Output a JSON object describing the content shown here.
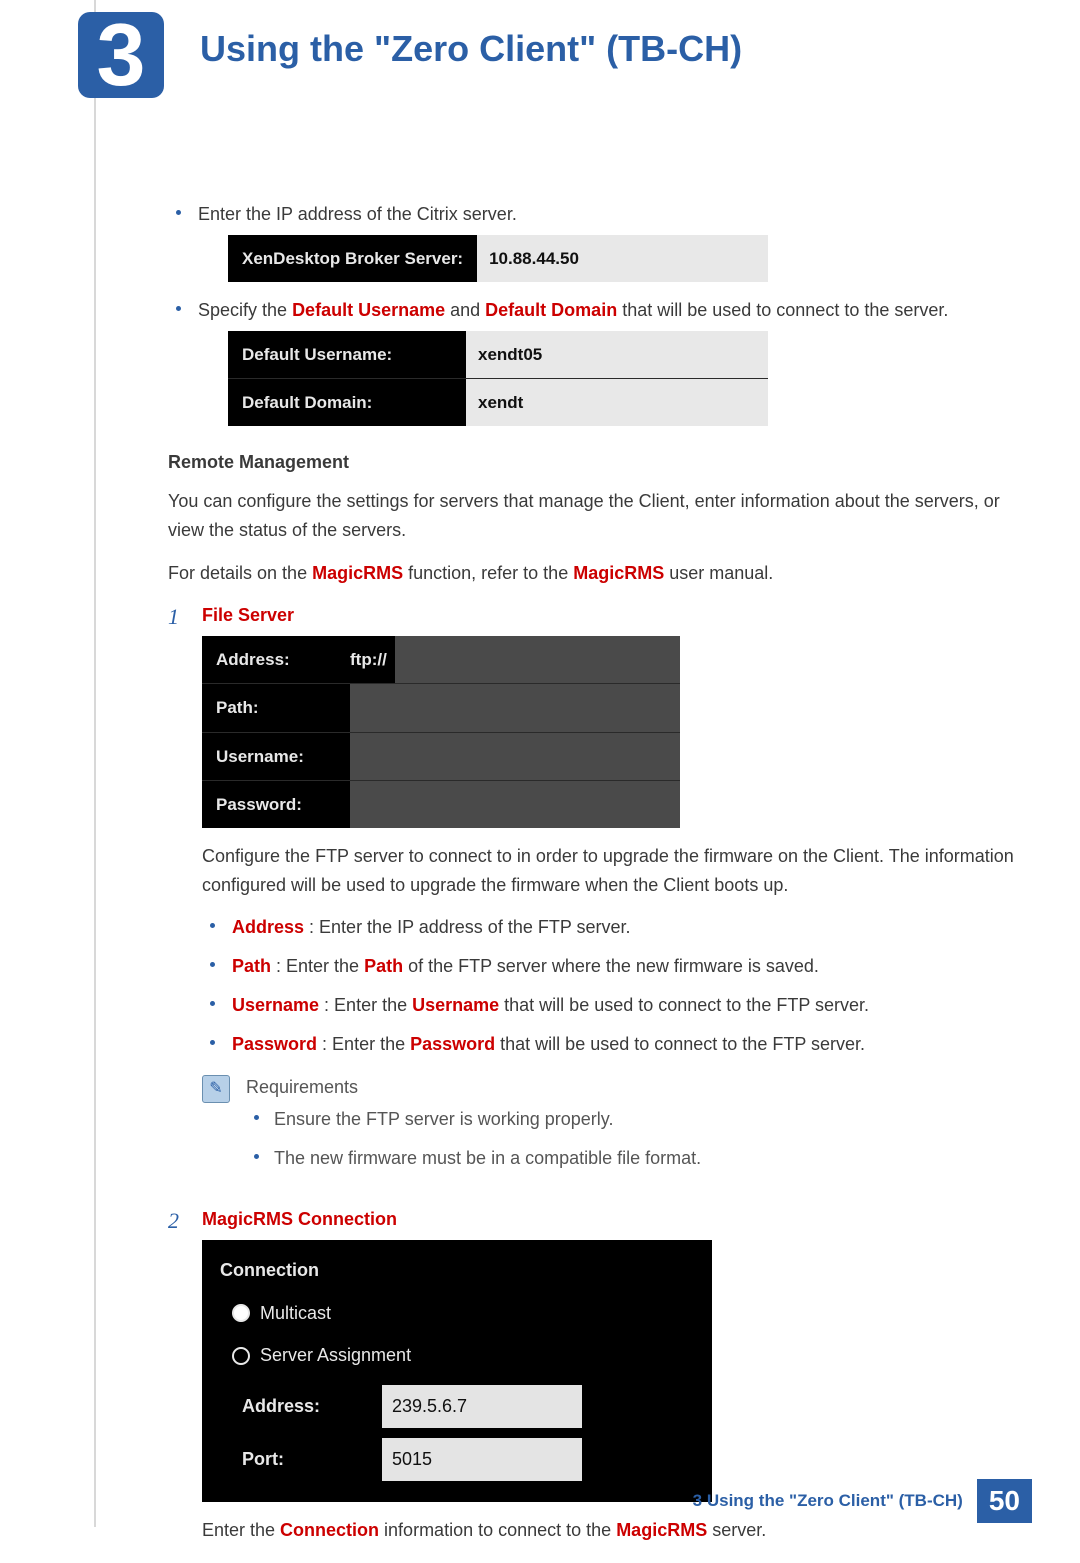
{
  "header": {
    "chapter_number": "3",
    "title": "Using the \"Zero Client\" (TB-CH)"
  },
  "bullets_top": {
    "b1": "Enter the IP address of the Citrix server.",
    "b2_pre": "Specify the ",
    "b2_h1": "Default Username",
    "b2_mid": " and ",
    "b2_h2": "Default Domain",
    "b2_post": " that will be used to connect to the server."
  },
  "img_broker": {
    "label": "XenDesktop Broker Server:",
    "value": "10.88.44.50"
  },
  "img_defaults": {
    "r1_label": "Default Username:",
    "r1_value": "xendt05",
    "r2_label": "Default Domain:",
    "r2_value": "xendt"
  },
  "remote": {
    "heading": "Remote Management",
    "p1": "You can configure the settings for servers that manage the Client, enter information about the servers, or view the status of the servers.",
    "p2_pre": "For details on the ",
    "p2_h1": "MagicRMS",
    "p2_mid": " function, refer to the ",
    "p2_h2": "MagicRMS",
    "p2_post": " user manual."
  },
  "step1": {
    "title": "File Server",
    "img": {
      "r1_label": "Address:",
      "r1_prefix": "ftp://",
      "r2_label": "Path:",
      "r3_label": "Username:",
      "r4_label": "Password:"
    },
    "p1": "Configure the FTP server to connect to in order to upgrade the firmware on the Client. The information configured will be used to upgrade the firmware when the Client boots up.",
    "sub": {
      "a_h": "Address",
      "a_t": " : Enter the IP address of the FTP server.",
      "b_h": "Path",
      "b_t_pre": " : Enter the ",
      "b_t_h": "Path",
      "b_t_post": " of the FTP server where the new firmware is saved.",
      "c_h": "Username",
      "c_t_pre": " : Enter the ",
      "c_t_h": "Username",
      "c_t_post": " that will be used to connect to the FTP server.",
      "d_h": "Password",
      "d_t_pre": " : Enter the ",
      "d_t_h": "Password",
      "d_t_post": " that will be used to connect to the FTP server."
    },
    "note": {
      "title": "Requirements",
      "n1": "Ensure the FTP server is working properly.",
      "n2": "The new firmware must be in a compatible file format."
    }
  },
  "step2": {
    "title": "MagicRMS Connection",
    "img": {
      "heading": "Connection",
      "opt1": "Multicast",
      "opt2": "Server Assignment",
      "addr_label": "Address:",
      "addr_value": "239.5.6.7",
      "port_label": "Port:",
      "port_value": "5015"
    },
    "p_pre": "Enter the ",
    "p_h1": "Connection",
    "p_mid": " information to connect to the ",
    "p_h2": "MagicRMS",
    "p_post": " server."
  },
  "footer": {
    "text": "3 Using the \"Zero Client\" (TB-CH)",
    "page": "50"
  }
}
